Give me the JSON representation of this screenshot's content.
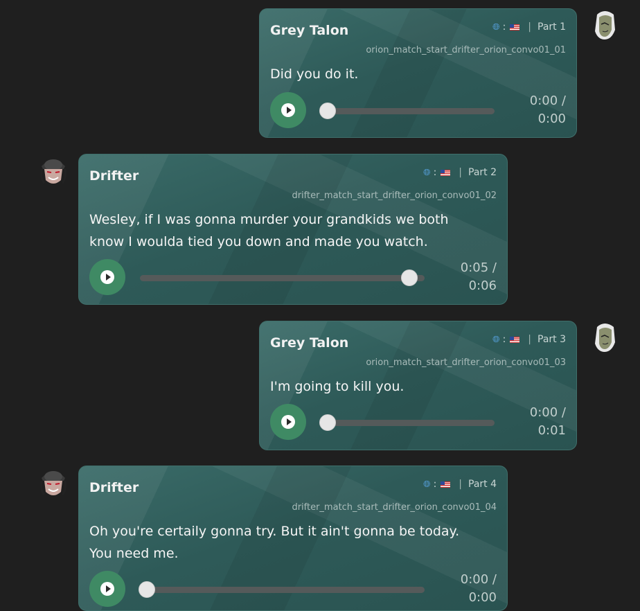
{
  "messages": [
    {
      "speaker": "Grey Talon",
      "part": "Part 1",
      "code": "orion_match_start_drifter_orion_convo01_01",
      "text": [
        "Did you do it."
      ],
      "time_current": "0:00 /",
      "time_total": "0:00",
      "progress": 0.0
    },
    {
      "speaker": "Drifter",
      "part": "Part 2",
      "code": "drifter_match_start_drifter_orion_convo01_02",
      "text": [
        "Wesley, if I was gonna murder your grandkids we both",
        "know I woulda tied you down and made you watch."
      ],
      "time_current": "0:05 /",
      "time_total": "0:06",
      "progress": 0.95
    },
    {
      "speaker": "Grey Talon",
      "part": "Part 3",
      "code": "orion_match_start_drifter_orion_convo01_03",
      "text": [
        "I'm going to kill you."
      ],
      "time_current": "0:00 /",
      "time_total": "0:01",
      "progress": 0.0
    },
    {
      "speaker": "Drifter",
      "part": "Part 4",
      "code": "drifter_match_start_drifter_orion_convo01_04",
      "text": [
        "Oh you're certaily gonna try. But it ain't gonna be today.",
        "You need me."
      ],
      "time_current": "0:00 /",
      "time_total": "0:00",
      "progress": 0.0
    }
  ],
  "icons": {
    "language": "globe-icon",
    "flag": "us-flag-icon",
    "play": "play-icon"
  },
  "colors": {
    "background": "#1f1f1f",
    "bubble": "#2e5a58",
    "play_button": "#3f8a64",
    "track": "#555a5a"
  }
}
